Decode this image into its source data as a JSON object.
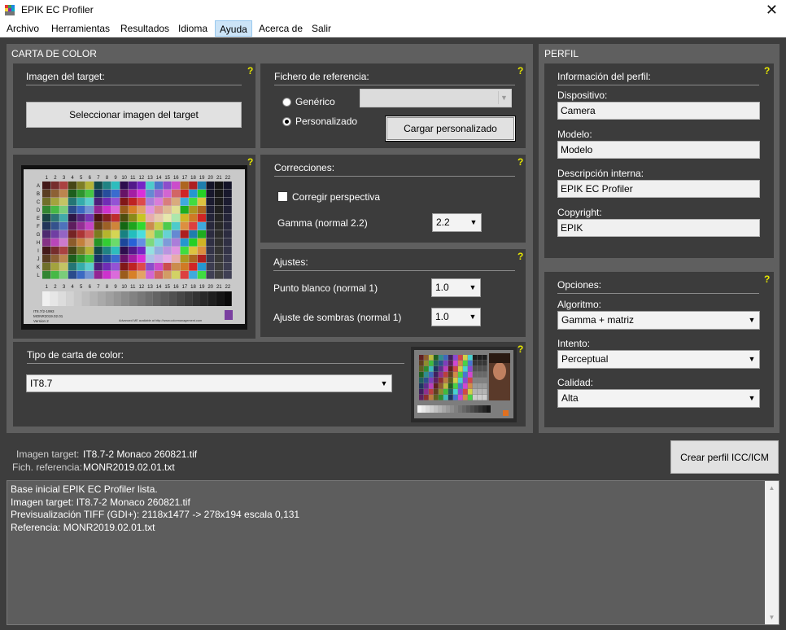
{
  "window": {
    "title": "EPIK EC Profiler",
    "close_glyph": "✕"
  },
  "menu": [
    "Archivo",
    "Herramientas",
    "Resultados",
    "Idioma",
    "Ayuda",
    "Acerca de",
    "Salir"
  ],
  "help_glyph": "?",
  "carta": {
    "title": "CARTA DE COLOR",
    "imagen_target": {
      "header": "Imagen del target:",
      "button": "Seleccionar imagen del target"
    },
    "fichero": {
      "header": "Fichero de referencia:",
      "generico": "Genérico",
      "personalizado": "Personalizado",
      "selected": "Personalizado",
      "generico_value": "",
      "button": "Cargar personalizado"
    },
    "correcciones": {
      "header": "Correcciones:",
      "perspectiva": "Corregir perspectiva",
      "perspectiva_checked": false,
      "gamma_label": "Gamma (normal 2.2)",
      "gamma_value": "2.2"
    },
    "ajustes": {
      "header": "Ajustes:",
      "punto_blanco_label": "Punto blanco (normal 1)",
      "punto_blanco_value": "1.0",
      "sombras_label": "Ajuste de sombras (normal 1)",
      "sombras_value": "1.0"
    },
    "tipo": {
      "header": "Tipo de carta de color:",
      "value": "IT8.7"
    },
    "preview": {
      "chart_name": "IT8.7/2-1993",
      "chart_sub": "MONR2019.02.01",
      "chart_version": "Version 2",
      "footer_text": "Advanced ME available at http://www.colormanagement.com",
      "col_numbers": [
        "1",
        "2",
        "3",
        "4",
        "5",
        "6",
        "7",
        "8",
        "9",
        "10",
        "11",
        "12",
        "13",
        "14",
        "15",
        "16",
        "17",
        "18",
        "19",
        "20",
        "21",
        "22"
      ],
      "row_letters": [
        "A",
        "B",
        "C",
        "D",
        "E",
        "F",
        "G",
        "H",
        "I",
        "J",
        "K",
        "L"
      ]
    }
  },
  "perfil": {
    "title": "PERFIL",
    "info": {
      "header": "Información del perfil:",
      "dispositivo_label": "Dispositivo:",
      "dispositivo": "Camera",
      "modelo_label": "Modelo:",
      "modelo": "Modelo",
      "descripcion_label": "Descripción interna:",
      "descripcion": "EPIK EC Profiler",
      "copyright_label": "Copyright:",
      "copyright": "EPIK"
    },
    "opciones": {
      "header": "Opciones:",
      "algoritmo_label": "Algoritmo:",
      "algoritmo": "Gamma + matriz",
      "intento_label": "Intento:",
      "intento": "Perceptual",
      "calidad_label": "Calidad:",
      "calidad": "Alta"
    }
  },
  "status": {
    "imagen_label": "Imagen target:",
    "imagen_value": "IT8.7-2 Monaco 260821.tif",
    "referencia_label": "Fich. referencia:",
    "referencia_value": "MONR2019.02.01.txt",
    "crear_button": "Crear perfil ICC/ICM"
  },
  "log": [
    "Base inicial EPIK EC Profiler lista.",
    "Imagen target: IT8.7-2 Monaco 260821.tif",
    "Previsualización TIFF (GDI+): 2118x1477 -> 278x194 escala 0,131",
    "Referencia: MONR2019.02.01.txt"
  ],
  "icons": {
    "app": "app-palette-icon",
    "close": "close-icon",
    "dropdown": "chevron-down-icon",
    "scroll_up": "scroll-up-arrow-icon",
    "scroll_down": "scroll-down-arrow-icon",
    "help": "help-question-icon"
  }
}
